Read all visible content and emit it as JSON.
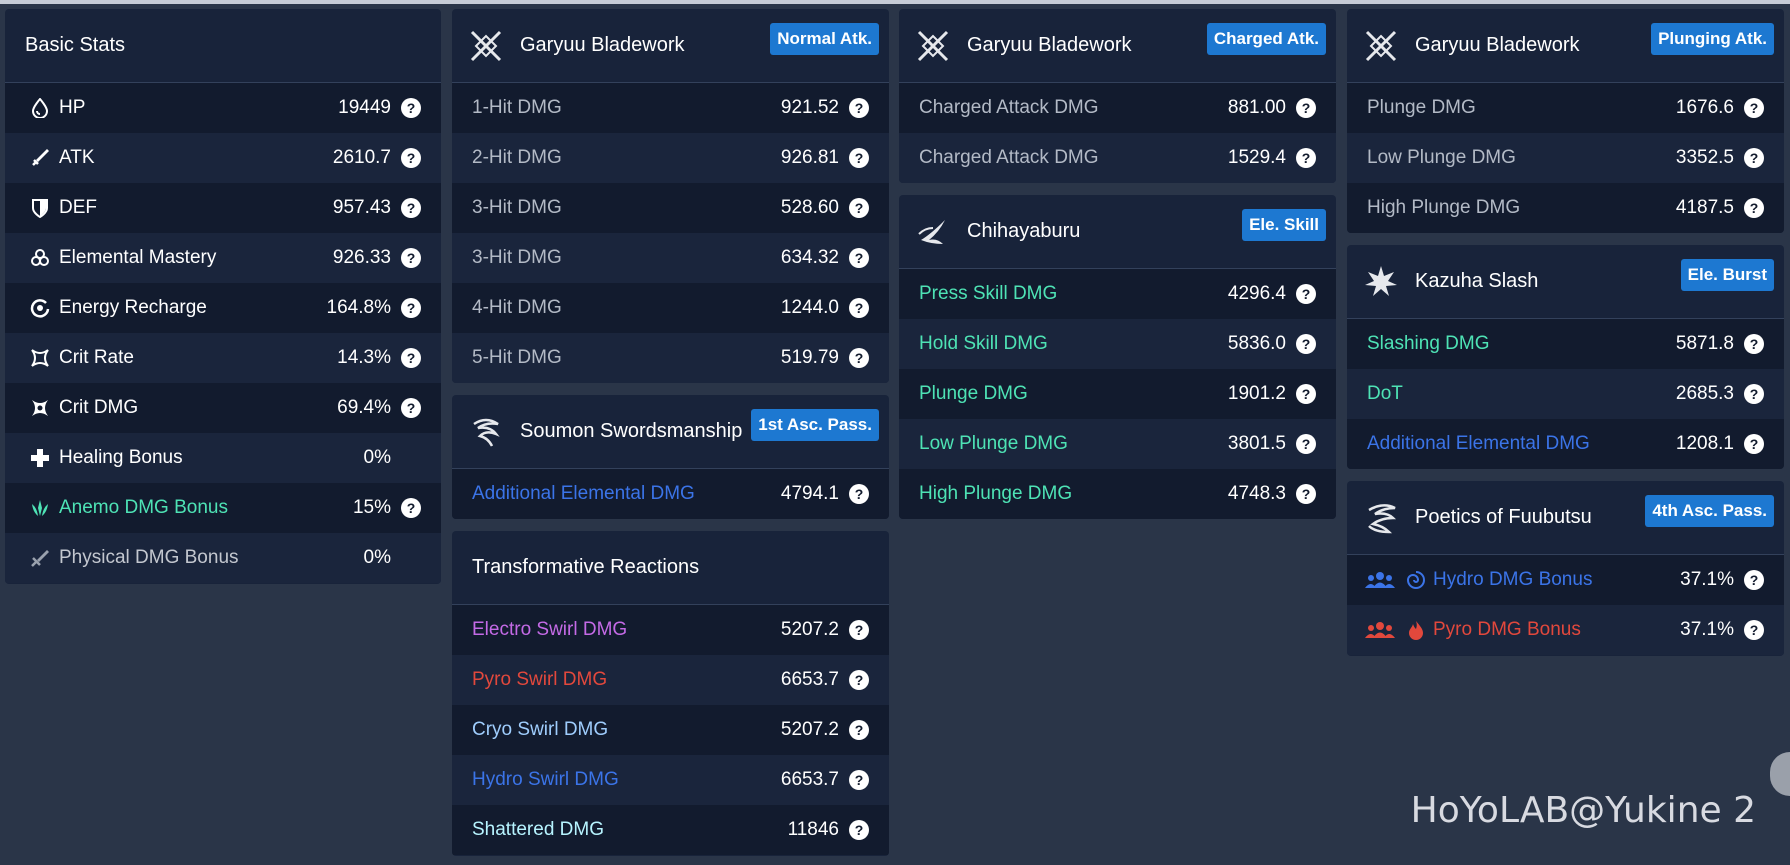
{
  "basic_stats": {
    "title": "Basic Stats",
    "rows": [
      {
        "icon": "hp-drop-icon",
        "label": "HP",
        "value": "19449",
        "help": true
      },
      {
        "icon": "atk-sword-icon",
        "label": "ATK",
        "value": "2610.7",
        "help": true
      },
      {
        "icon": "def-shield-icon",
        "label": "DEF",
        "value": "957.43",
        "help": true
      },
      {
        "icon": "elemental-mastery-icon",
        "label": "Elemental Mastery",
        "value": "926.33",
        "help": true
      },
      {
        "icon": "energy-recharge-icon",
        "label": "Energy Recharge",
        "value": "164.8%",
        "help": true
      },
      {
        "icon": "crit-rate-icon",
        "label": "Crit Rate",
        "value": "14.3%",
        "help": true
      },
      {
        "icon": "crit-dmg-icon",
        "label": "Crit DMG",
        "value": "69.4%",
        "help": true
      },
      {
        "icon": "healing-cross-icon",
        "label": "Healing Bonus",
        "value": "0%",
        "help": false
      },
      {
        "icon": "anemo-icon",
        "label": "Anemo DMG Bonus",
        "value": "15%",
        "help": true
      },
      {
        "icon": "physical-icon",
        "label": "Physical DMG Bonus",
        "value": "0%",
        "help": false
      }
    ]
  },
  "normal_attack": {
    "title": "Garyuu Bladework",
    "badge": "Normal Atk.",
    "rows": [
      {
        "label": "1-Hit DMG",
        "value": "921.52"
      },
      {
        "label": "2-Hit DMG",
        "value": "926.81"
      },
      {
        "label": "3-Hit DMG",
        "value": "528.60"
      },
      {
        "label": "3-Hit DMG",
        "value": "634.32"
      },
      {
        "label": "4-Hit DMG",
        "value": "1244.0"
      },
      {
        "label": "5-Hit DMG",
        "value": "519.79"
      }
    ]
  },
  "first_passive": {
    "title": "Soumon Swordsmanship",
    "badge": "1st Asc. Pass.",
    "rows": [
      {
        "label": "Additional Elemental DMG",
        "value": "4794.1"
      }
    ]
  },
  "transformative": {
    "title": "Transformative Reactions",
    "rows": [
      {
        "label": "Electro Swirl DMG",
        "value": "5207.2"
      },
      {
        "label": "Pyro Swirl DMG",
        "value": "6653.7"
      },
      {
        "label": "Cryo Swirl DMG",
        "value": "5207.2"
      },
      {
        "label": "Hydro Swirl DMG",
        "value": "6653.7"
      },
      {
        "label": "Shattered DMG",
        "value": "11846"
      }
    ]
  },
  "charged_attack": {
    "title": "Garyuu Bladework",
    "badge": "Charged Atk.",
    "rows": [
      {
        "label": "Charged Attack DMG",
        "value": "881.00"
      },
      {
        "label": "Charged Attack DMG",
        "value": "1529.4"
      }
    ]
  },
  "ele_skill": {
    "title": "Chihayaburu",
    "badge": "Ele. Skill",
    "rows": [
      {
        "label": "Press Skill DMG",
        "value": "4296.4"
      },
      {
        "label": "Hold Skill DMG",
        "value": "5836.0"
      },
      {
        "label": "Plunge DMG",
        "value": "1901.2"
      },
      {
        "label": "Low Plunge DMG",
        "value": "3801.5"
      },
      {
        "label": "High Plunge DMG",
        "value": "4748.3"
      }
    ]
  },
  "plunging_attack": {
    "title": "Garyuu Bladework",
    "badge": "Plunging Atk.",
    "rows": [
      {
        "label": "Plunge DMG",
        "value": "1676.6"
      },
      {
        "label": "Low Plunge DMG",
        "value": "3352.5"
      },
      {
        "label": "High Plunge DMG",
        "value": "4187.5"
      }
    ]
  },
  "ele_burst": {
    "title": "Kazuha Slash",
    "badge": "Ele. Burst",
    "rows": [
      {
        "label": "Slashing DMG",
        "value": "5871.8"
      },
      {
        "label": "DoT",
        "value": "2685.3"
      },
      {
        "label": "Additional Elemental DMG",
        "value": "1208.1"
      }
    ]
  },
  "fourth_passive": {
    "title": "Poetics of Fuubutsu",
    "badge": "4th Asc. Pass.",
    "rows": [
      {
        "label": "Hydro DMG Bonus",
        "value": "37.1%"
      },
      {
        "label": "Pyro DMG Bonus",
        "value": "37.1%"
      }
    ]
  },
  "help_glyph": "?",
  "watermark": "HoYoLAB@Yukine 2",
  "colors": {
    "anemo": "#4ee3b5",
    "hydro": "#3b74e8",
    "pyro": "#e2483c",
    "electro": "#c46ae6",
    "cryo": "#9fcdfd",
    "badge": "#1d78d1"
  }
}
